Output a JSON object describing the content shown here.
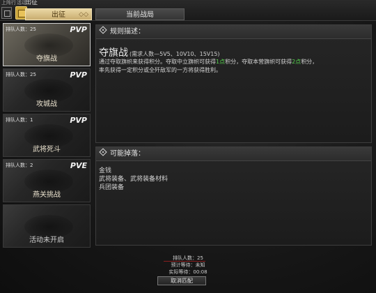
{
  "topbar": {
    "small_left": "上阵行",
    "small_mid": "活动",
    "title_partial": "出征",
    "tabs": [
      {
        "label": "出征",
        "deco": "◇◇"
      },
      {
        "label": "当前战局"
      }
    ]
  },
  "modes": [
    {
      "queue": "排队人数：25",
      "mode": "PVP",
      "name": "夺旗战",
      "selected": true
    },
    {
      "queue": "排队人数：25",
      "mode": "PVP",
      "name": "攻城战",
      "selected": false
    },
    {
      "queue": "排队人数：1",
      "mode": "PVP",
      "name": "武将死斗",
      "selected": false
    },
    {
      "queue": "排队人数：2",
      "mode": "PVE",
      "name": "燕关挑战",
      "selected": false
    },
    {
      "queue": "",
      "mode": "",
      "name": "活动未开启",
      "selected": false
    }
  ],
  "rules": {
    "header": "规则描述：",
    "title": "夺旗战",
    "subtitle": "(需求人数—5V5、10V10、15V15)",
    "line1_a": "通过夺取旗帜来获得积分。夺取中立旗帜可获得",
    "line1_b": "1点",
    "line1_c": "积分，夺取本营旗帜可获得",
    "line1_d": "2点",
    "line1_e": "积分，",
    "line2": "率先获得一定积分或全歼敌军的一方将获得胜利。"
  },
  "drops": {
    "header": "可能掉落：",
    "items": [
      "金钱",
      "武将装备、武将装备材料",
      "兵团装备"
    ]
  },
  "bottom": {
    "queue": "排队人数：25",
    "expected_wait": "预计等待：未知",
    "actual_wait": "实际等待：00:08",
    "cancel_label": "取消匹配"
  },
  "colors": {
    "accent_gold": "#c9ad70",
    "highlight_green": "#56d34e"
  }
}
